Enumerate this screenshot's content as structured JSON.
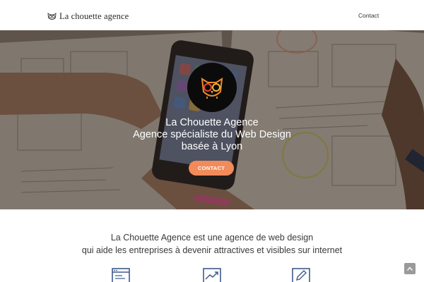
{
  "navbar": {
    "brand": "La chouette agence",
    "links": [
      {
        "label": "Contact"
      }
    ]
  },
  "hero": {
    "title_lines": [
      "La Chouette Agence",
      "Agence spécialiste du Web Design",
      "basée à Lyon"
    ],
    "cta_label": "Contact",
    "logo_icon": "owl-logo-icon"
  },
  "intro": {
    "lines": [
      "La Chouette Agence est une agence de web design",
      "qui aide les entreprises à devenir attractives et visibles sur internet"
    ]
  },
  "features": [
    {
      "icon": "browser-window-icon"
    },
    {
      "icon": "trending-chart-icon"
    },
    {
      "icon": "pencil-edit-icon"
    }
  ],
  "colors": {
    "accent": "#f28a5a",
    "hero_overlay": "#3a2a20",
    "text": "#3a3a3a",
    "icon_blue": "#3e5a8a"
  }
}
